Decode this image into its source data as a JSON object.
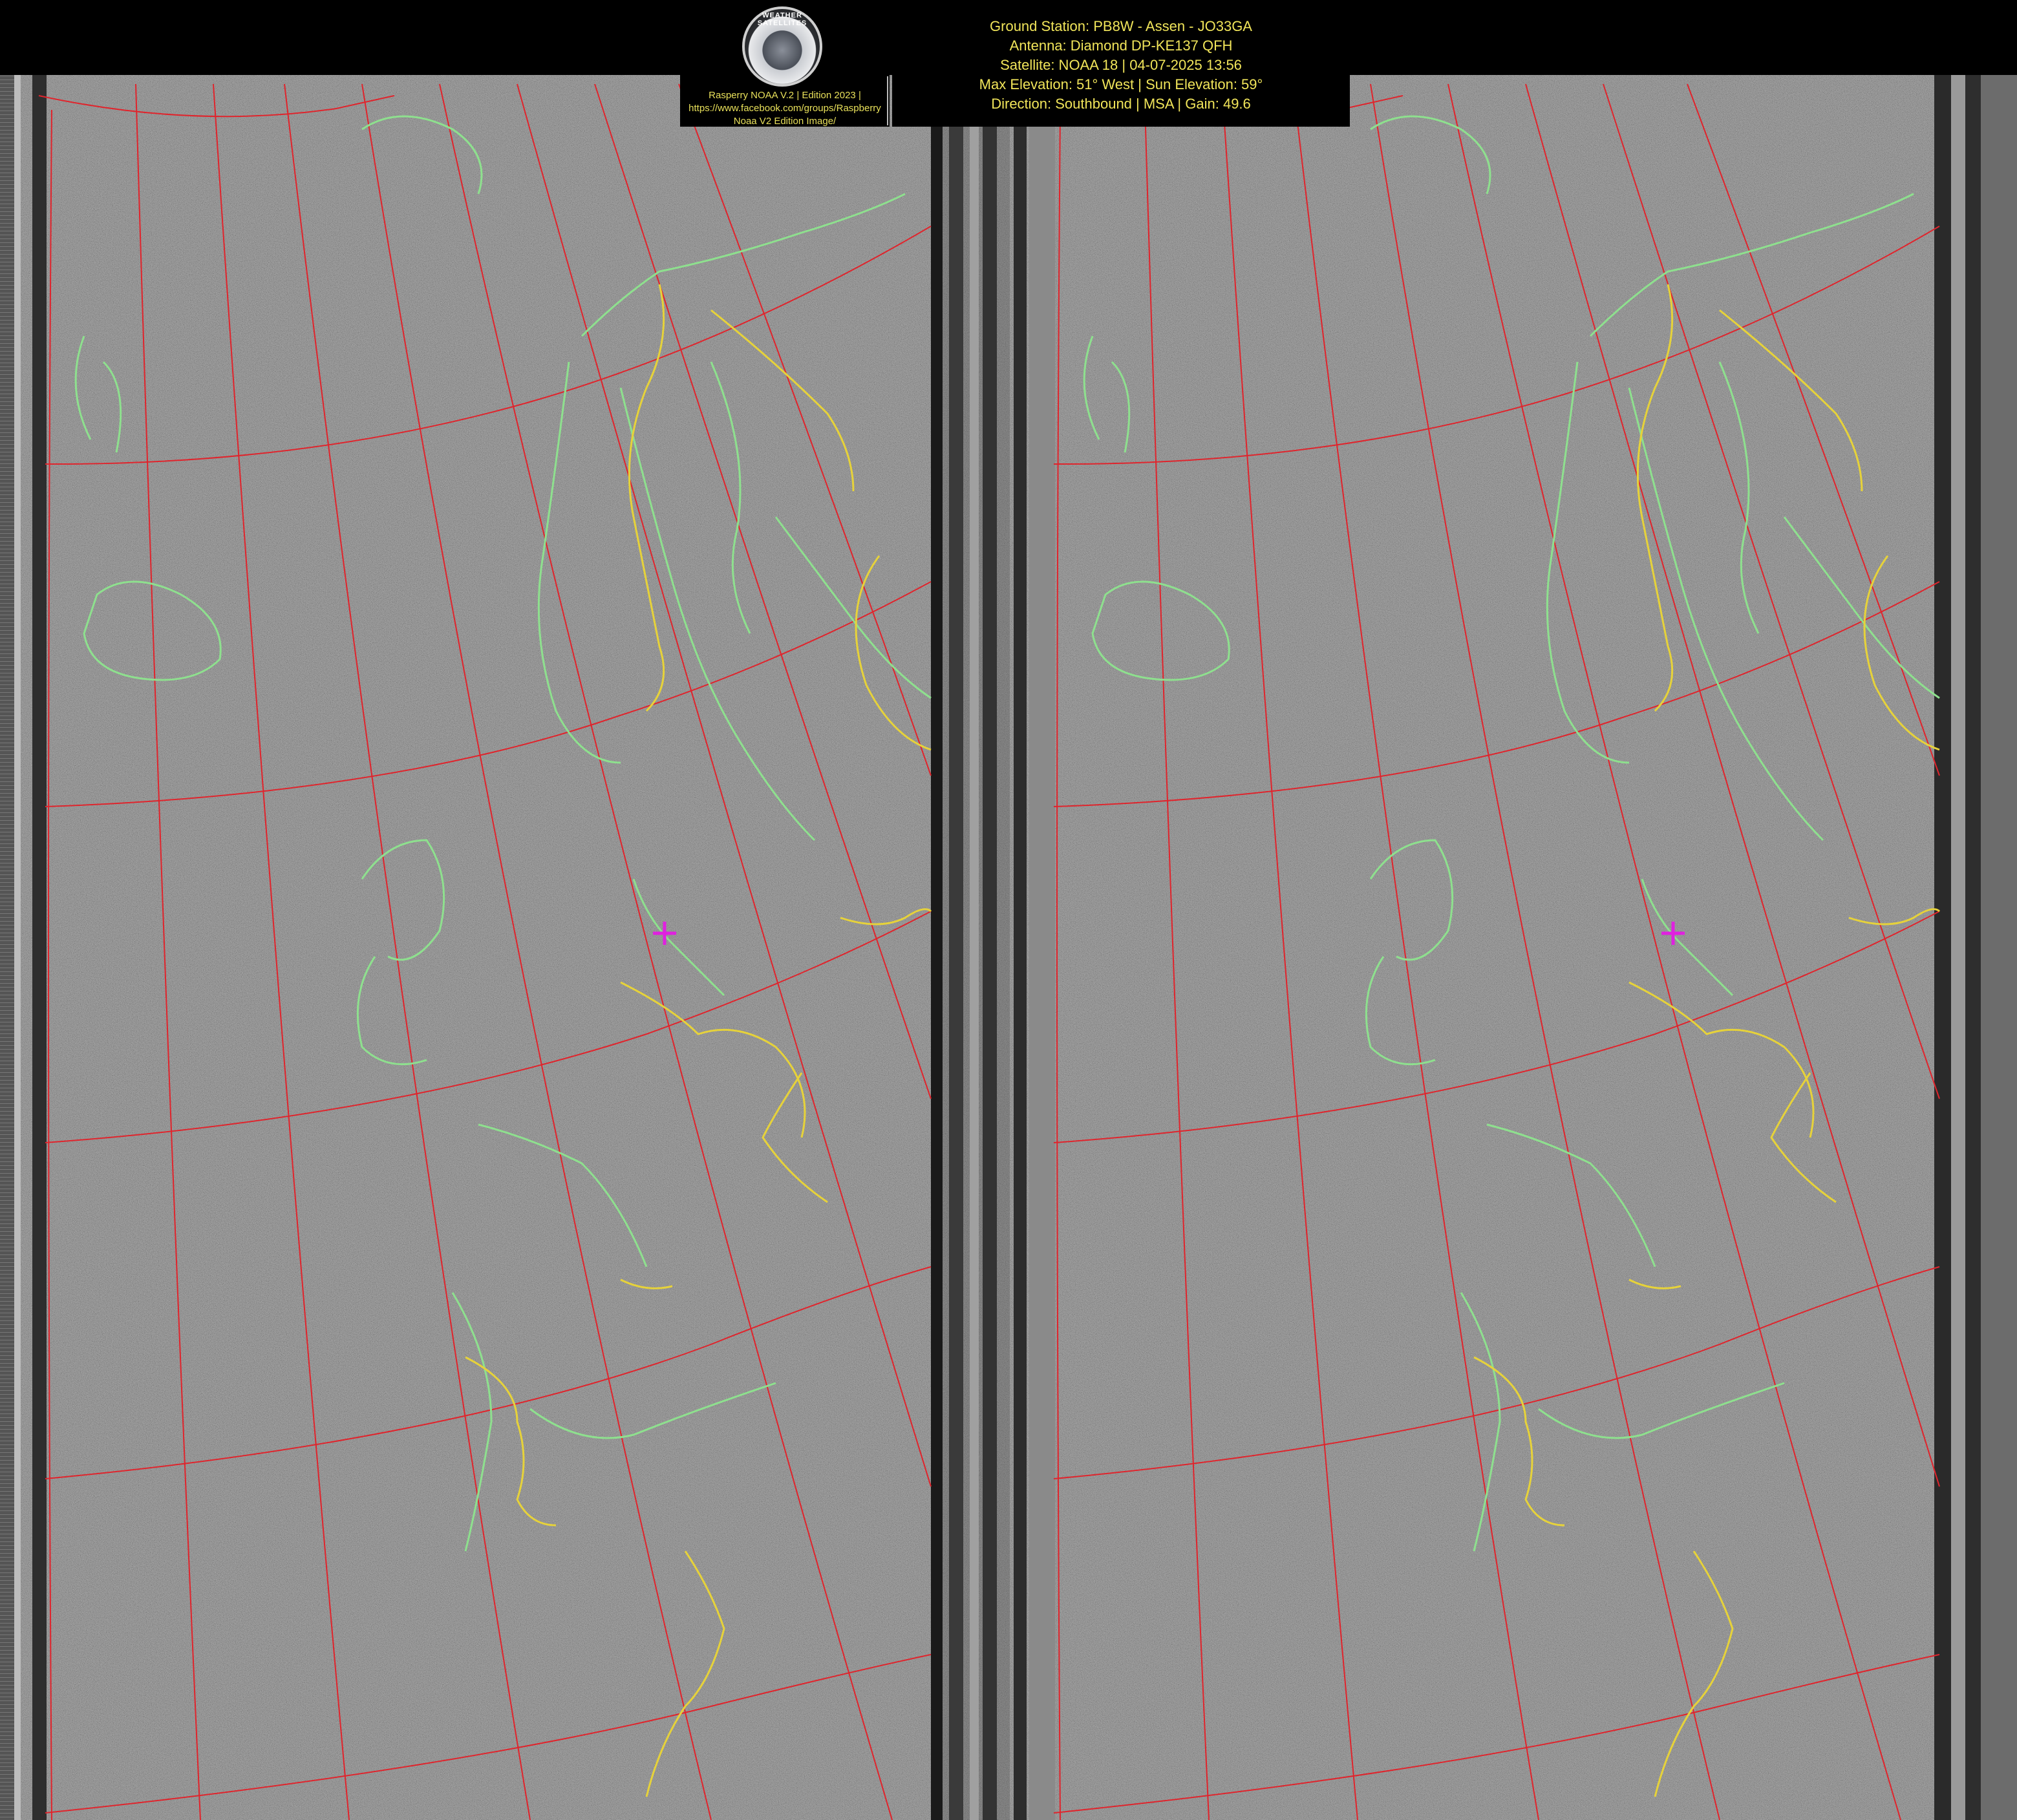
{
  "header": {
    "logo_ring_text": "WEATHER SATELLITES",
    "credit_lines": [
      "Rasperry NOAA V.2 | Edition 2023 |",
      "https://www.facebook.com/groups/Raspberry",
      "Noaa V2 Edition Image/"
    ],
    "info_lines": [
      "Ground Station: PB8W - Assen - JO33GA",
      "Antenna: Diamond DP-KE137 QFH",
      "Satellite: NOAA 18 | 04-07-2025 13:56",
      "Max Elevation: 51° West | Sun Elevation: 59°",
      "Direction: Southbound | MSA | Gain: 49.6"
    ]
  },
  "colors": {
    "background": "#000000",
    "noise_gray": "#8c8c8c",
    "grid_red": "#e0242c",
    "coast_green": "#8ee08e",
    "border_yellow": "#e6d23a",
    "marker_magenta": "#e020e0",
    "header_text": "#f1e55a"
  },
  "icons": {
    "logo": "weather-satellites-logo-icon",
    "station_marker": "crosshair-plus-icon"
  }
}
